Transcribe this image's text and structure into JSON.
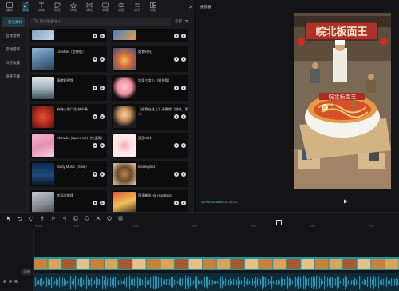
{
  "toolbar": {
    "tools": [
      {
        "label": "媒体",
        "icon": "media-icon",
        "active": false
      },
      {
        "label": "音频",
        "icon": "music-note-icon",
        "active": true
      },
      {
        "label": "文本",
        "icon": "text-icon",
        "active": false
      },
      {
        "label": "贴纸",
        "icon": "sticker-icon",
        "active": false
      },
      {
        "label": "特效",
        "icon": "effects-icon",
        "active": false
      },
      {
        "label": "转场",
        "icon": "transition-icon",
        "active": false
      },
      {
        "label": "字幕",
        "icon": "captions-icon",
        "active": false
      },
      {
        "label": "滤镜",
        "icon": "filter-icon",
        "active": false
      },
      {
        "label": "调节",
        "icon": "adjust-icon",
        "active": false
      },
      {
        "label": "模板",
        "icon": "template-icon",
        "active": false
      }
    ]
  },
  "sidebar": {
    "items": [
      {
        "label": "• 音乐素材",
        "active": true
      },
      {
        "label": "音效素材",
        "active": false
      },
      {
        "label": "音频提取",
        "active": false
      },
      {
        "label": "抖音收藏",
        "active": false
      },
      {
        "label": "链接下载",
        "active": false
      }
    ]
  },
  "search": {
    "placeholder": "搜索歌曲/艺人",
    "filter_label": "全部"
  },
  "music": [
    {
      "title": "",
      "sub": ""
    },
    {
      "title": "",
      "sub": ""
    },
    {
      "title": "Lifestyle（欢快版）",
      "sub": ""
    },
    {
      "title": "美食时光",
      "sub": ""
    },
    {
      "title": "情绪短视频",
      "sub": ""
    },
    {
      "title": "恋爱少女心（轻快版）",
      "sub": ""
    },
    {
      "title": "麻辣火锅广告·快节奏",
      "sub": ""
    },
    {
      "title": "《接我在这儿》无需就（翻唱，版",
      "sub": "本）"
    },
    {
      "title": "Shosaku (Speed Up)（快速版）",
      "sub": ""
    },
    {
      "title": "甜甜咔咔",
      "sub": ""
    },
    {
      "title": "Booty Music（Slow）",
      "sub": ""
    },
    {
      "title": "Monkeybox",
      "sub": ""
    },
    {
      "title": "欢乐的旋律",
      "sub": ""
    },
    {
      "title": "国潮新年Hip Hop Beat",
      "sub": ""
    }
  ],
  "player": {
    "title": "播放器",
    "time_current": "00:00:00:00",
    "time_total": "00:00:25:01"
  },
  "video_sign": "皖北板面王",
  "bowl_sign": "皖北板面王",
  "timeline": {
    "ticks": [
      "00:00",
      "1:00",
      "2:00",
      "3:00",
      "4:00",
      "5:00",
      "6:00"
    ],
    "cover_label": "封面"
  }
}
